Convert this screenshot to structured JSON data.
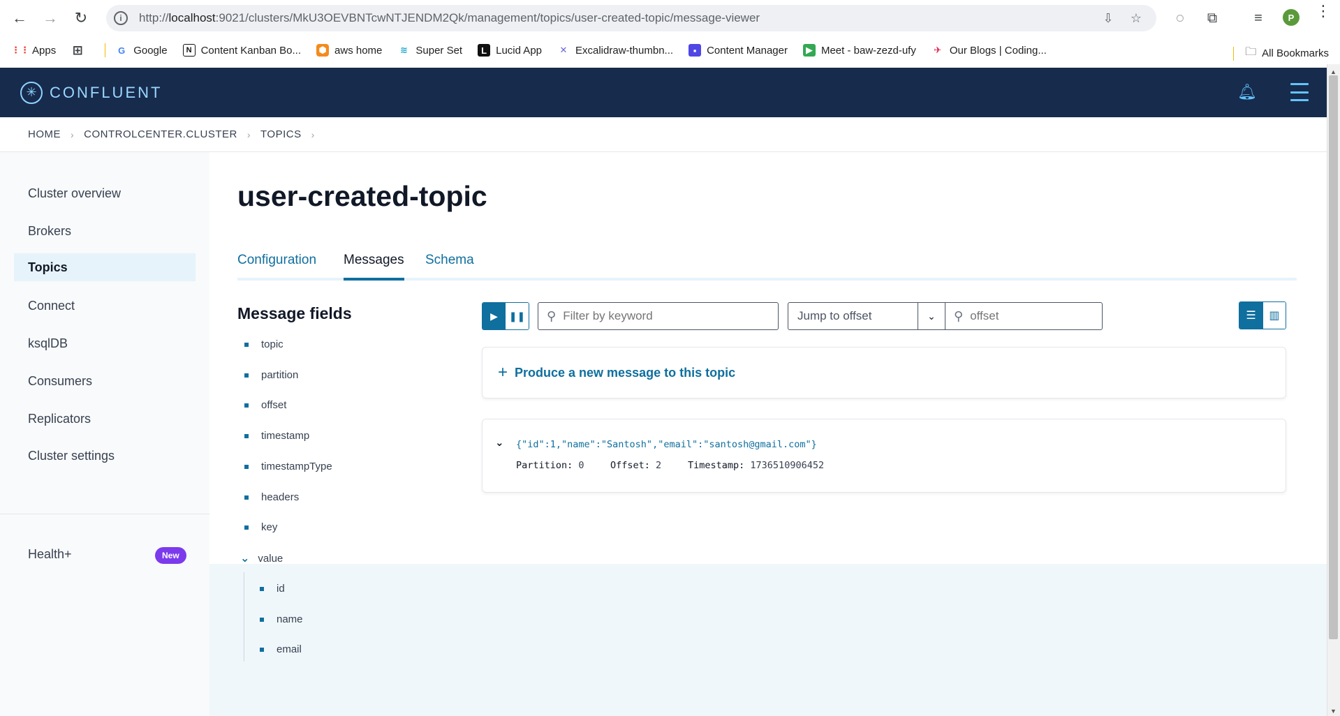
{
  "browser": {
    "url_prefix": "http://",
    "url_host": "localhost",
    "url_rest": ":9021/clusters/MkU3OEVBNTcwNTJENDM2Qk/management/topics/user-created-topic/message-viewer",
    "profile_initial": "P",
    "bookmarks": [
      {
        "label": "Apps",
        "icon": "apps-grid-icon"
      },
      {
        "label": "",
        "icon": "grid-icon"
      },
      {
        "label": "Google",
        "icon": "google-icon"
      },
      {
        "label": "Content Kanban Bo...",
        "icon": "notion-icon"
      },
      {
        "label": "aws home",
        "icon": "aws-icon"
      },
      {
        "label": "Super Set",
        "icon": "superset-icon"
      },
      {
        "label": "Lucid App",
        "icon": "lucid-icon"
      },
      {
        "label": "Excalidraw-thumbn...",
        "icon": "excalidraw-icon"
      },
      {
        "label": "Content Manager",
        "icon": "content-manager-icon"
      },
      {
        "label": "Meet - baw-zezd-ufy",
        "icon": "meet-icon"
      },
      {
        "label": "Our Blogs | Coding...",
        "icon": "blog-icon"
      }
    ],
    "all_bookmarks": "All Bookmarks"
  },
  "header": {
    "brand": "CONFLUENT"
  },
  "breadcrumb": [
    "HOME",
    "CONTROLCENTER.CLUSTER",
    "TOPICS"
  ],
  "sidebar": {
    "items": [
      {
        "label": "Cluster overview",
        "active": false
      },
      {
        "label": "Brokers",
        "active": false
      },
      {
        "label": "Topics",
        "active": true
      },
      {
        "label": "Connect",
        "active": false
      },
      {
        "label": "ksqlDB",
        "active": false
      },
      {
        "label": "Consumers",
        "active": false
      },
      {
        "label": "Replicators",
        "active": false
      },
      {
        "label": "Cluster settings",
        "active": false
      }
    ],
    "health": "Health+",
    "new_badge": "New"
  },
  "main": {
    "title": "user-created-topic",
    "tabs": [
      {
        "label": "Configuration",
        "active": false
      },
      {
        "label": "Messages",
        "active": true
      },
      {
        "label": "Schema",
        "active": false
      }
    ],
    "message_fields": {
      "title": "Message fields",
      "fields": [
        "topic",
        "partition",
        "offset",
        "timestamp",
        "timestampType",
        "headers",
        "key"
      ],
      "value_label": "value",
      "value_children": [
        "id",
        "name",
        "email"
      ]
    },
    "controls": {
      "filter_placeholder": "Filter by keyword",
      "jump_label": "Jump to offset",
      "offset_placeholder": "offset"
    },
    "produce_label": "Produce a new message to this topic",
    "message": {
      "json": "{\"id\":1,\"name\":\"Santosh\",\"email\":\"santosh@gmail.com\"}",
      "partition_label": "Partition:",
      "partition": "0",
      "offset_label": "Offset:",
      "offset": "2",
      "timestamp_label": "Timestamp:",
      "timestamp": "1736510906452"
    }
  }
}
